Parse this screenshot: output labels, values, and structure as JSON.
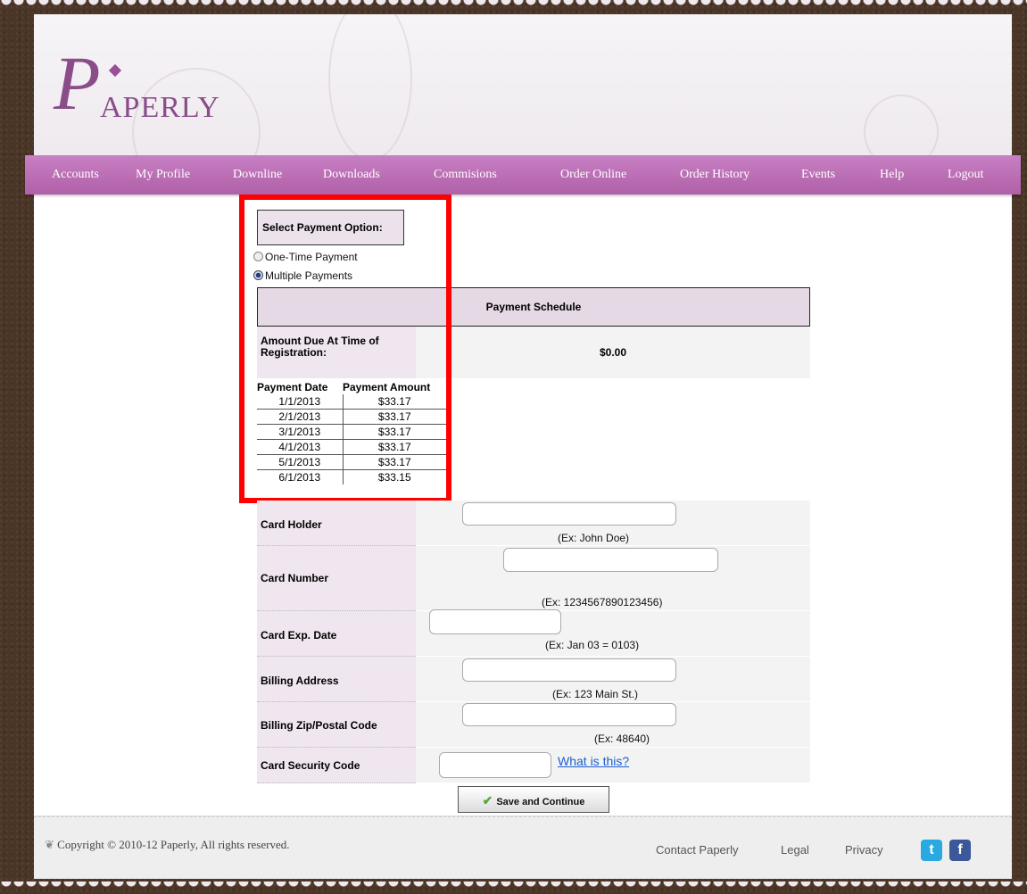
{
  "brand": {
    "logo_letter": "P",
    "logo_text": "APERLY"
  },
  "nav": {
    "items": [
      "Accounts",
      "My Profile",
      "Downline",
      "Downloads",
      "Commisions",
      "Order Online",
      "Order History",
      "Events",
      "Help",
      "Logout"
    ]
  },
  "payment_option": {
    "title": "Select Payment Option:",
    "options": [
      {
        "label": "One-Time Payment",
        "selected": false
      },
      {
        "label": "Multiple Payments",
        "selected": true
      }
    ]
  },
  "schedule": {
    "title": "Payment Schedule",
    "amount_due_label": "Amount Due At Time of Registration:",
    "amount_due_value": "$0.00",
    "headers": [
      "Payment Date",
      "Payment Amount"
    ],
    "rows": [
      [
        "1/1/2013",
        "$33.17"
      ],
      [
        "2/1/2013",
        "$33.17"
      ],
      [
        "3/1/2013",
        "$33.17"
      ],
      [
        "4/1/2013",
        "$33.17"
      ],
      [
        "5/1/2013",
        "$33.17"
      ],
      [
        "6/1/2013",
        "$33.15"
      ]
    ]
  },
  "form": {
    "card_holder": {
      "label": "Card Holder",
      "value": "",
      "hint": "(Ex: John Doe)"
    },
    "card_number": {
      "label": "Card Number",
      "value": "",
      "hint": "(Ex: 1234567890123456)"
    },
    "card_exp": {
      "label": "Card Exp. Date",
      "value": "",
      "hint": "(Ex: Jan 03 = 0103)"
    },
    "billing_address": {
      "label": "Billing Address",
      "value": "",
      "hint": "(Ex: 123 Main St.)"
    },
    "billing_zip": {
      "label": "Billing Zip/Postal Code",
      "value": "",
      "hint": "(Ex: 48640)"
    },
    "security_code": {
      "label": "Card Security Code",
      "value": "",
      "link": "What is this?"
    }
  },
  "actions": {
    "save_label": "Save and Continue"
  },
  "footer": {
    "copyright": "Copyright © 2010-12 Paperly, All rights reserved.",
    "links": [
      "Contact Paperly",
      "Legal",
      "Privacy"
    ],
    "social": [
      {
        "icon": "twitter-icon",
        "glyph": "t",
        "color": "#29a9e1"
      },
      {
        "icon": "facebook-icon",
        "glyph": "f",
        "color": "#3b5998"
      }
    ]
  },
  "colors": {
    "nav": "#b868b0",
    "highlight": "#ff0000",
    "link": "#1a5fd0"
  }
}
